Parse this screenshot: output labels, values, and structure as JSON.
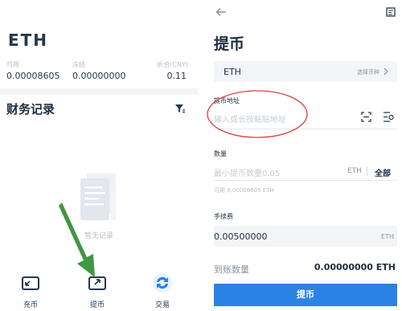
{
  "left": {
    "coin_name": "ETH",
    "balance_labels": [
      "可用",
      "冻结",
      "折合(CNY)"
    ],
    "balance_values": [
      "0.00008605",
      "0.00000000",
      "0.11"
    ],
    "records_title": "财务记录",
    "empty_text": "暂无记录",
    "nav": [
      {
        "label": "充币",
        "icon": "deposit-icon"
      },
      {
        "label": "提币",
        "icon": "withdraw-icon"
      },
      {
        "label": "交易",
        "icon": "exchange-icon"
      }
    ]
  },
  "right": {
    "page_title": "提币",
    "coin": {
      "value": "ETH",
      "select_text": "选择币种"
    },
    "address": {
      "label": "提币地址",
      "placeholder": "输入或长按粘贴地址"
    },
    "amount": {
      "label": "数量",
      "placeholder": "最小提币数量0.05",
      "unit": "ETH",
      "all_label": "全部",
      "available": "可用 0.00008605 ETH"
    },
    "fee": {
      "label": "手续费",
      "value": "0.00500000",
      "unit": "ETH"
    },
    "receive": {
      "label": "到账数量",
      "value": "0.00000000 ETH"
    },
    "submit_label": "提币"
  },
  "colors": {
    "accent": "#2a82e4",
    "highlight_ellipse": "#d9413a",
    "annotation_arrow": "#2e8b2e"
  }
}
